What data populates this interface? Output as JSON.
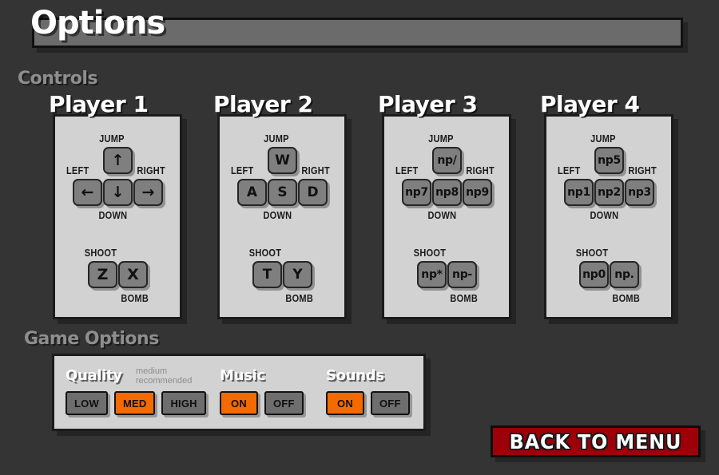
{
  "page": {
    "title": "Options",
    "background_color": "#343434",
    "panel_color": "#d2d2d2",
    "accent_color": "#f56a00",
    "button_color": "#9d0008"
  },
  "sections": {
    "controls_heading": "Controls",
    "game_options_heading": "Game Options"
  },
  "players": [
    {
      "title": "Player 1",
      "labels": {
        "jump": "JUMP",
        "left": "LEFT",
        "down": "DOWN",
        "right": "RIGHT",
        "shoot": "SHOOT",
        "bomb": "BOMB"
      },
      "keys": {
        "jump": "↑",
        "left": "←",
        "down": "↓",
        "right": "→",
        "shoot": "Z",
        "bomb": "X"
      },
      "key_style": "arrow"
    },
    {
      "title": "Player 2",
      "labels": {
        "jump": "JUMP",
        "left": "LEFT",
        "down": "DOWN",
        "right": "RIGHT",
        "shoot": "SHOOT",
        "bomb": "BOMB"
      },
      "keys": {
        "jump": "W",
        "left": "A",
        "down": "S",
        "right": "D",
        "shoot": "T",
        "bomb": "Y"
      },
      "key_style": "letter"
    },
    {
      "title": "Player 3",
      "labels": {
        "jump": "JUMP",
        "left": "LEFT",
        "down": "DOWN",
        "right": "RIGHT",
        "shoot": "SHOOT",
        "bomb": "BOMB"
      },
      "keys": {
        "jump": "np/",
        "left": "np7",
        "down": "np8",
        "right": "np9",
        "shoot": "np*",
        "bomb": "np-"
      },
      "key_style": "np"
    },
    {
      "title": "Player 4",
      "labels": {
        "jump": "JUMP",
        "left": "LEFT",
        "down": "DOWN",
        "right": "RIGHT",
        "shoot": "SHOOT",
        "bomb": "BOMB"
      },
      "keys": {
        "jump": "np5",
        "left": "np1",
        "down": "np2",
        "right": "np3",
        "shoot": "np0",
        "bomb": "np."
      },
      "key_style": "np"
    }
  ],
  "game_options": {
    "quality": {
      "title": "Quality",
      "note": "medium\nrecommended",
      "options": [
        "LOW",
        "MED",
        "HIGH"
      ],
      "selected": "MED"
    },
    "music": {
      "title": "Music",
      "options": [
        "ON",
        "OFF"
      ],
      "selected": "ON"
    },
    "sounds": {
      "title": "Sounds",
      "options": [
        "ON",
        "OFF"
      ],
      "selected": "ON"
    }
  },
  "back_button": {
    "label": "BACK TO MENU"
  }
}
